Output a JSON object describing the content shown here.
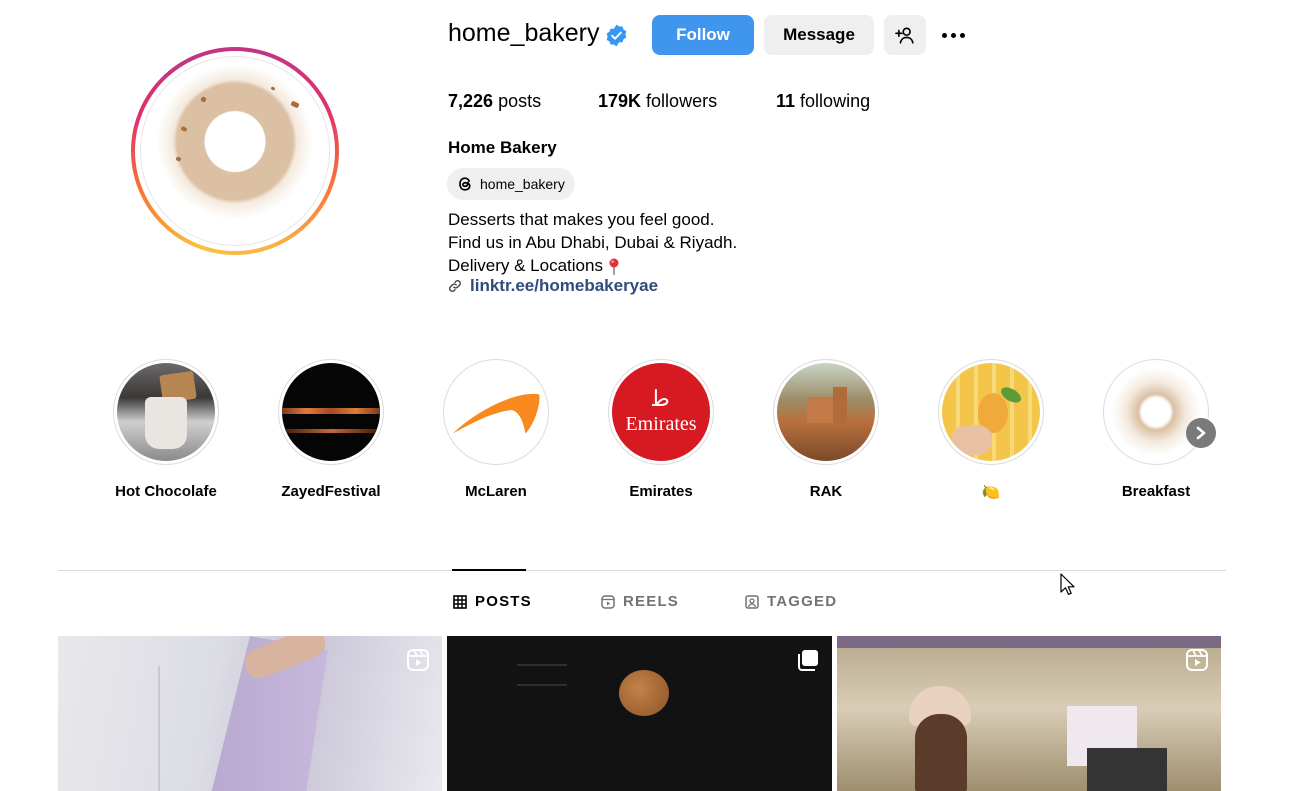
{
  "profile": {
    "username": "home_bakery",
    "display_name": "Home Bakery",
    "threads_handle": "home_bakery",
    "bio_lines": [
      "Desserts that makes you feel good.",
      "Find us in Abu Dhabi, Dubai & Riyadh.",
      "Delivery & Locations"
    ],
    "link": "linktr.ee/homebakeryae",
    "verified": true
  },
  "actions": {
    "follow_label": "Follow",
    "message_label": "Message"
  },
  "stats": {
    "posts_count": "7,226",
    "posts_label": "posts",
    "followers_count": "179K",
    "followers_label": "followers",
    "following_count": "11",
    "following_label": "following"
  },
  "highlights": [
    {
      "label": "Hot Chocolafe"
    },
    {
      "label": "ZayedFestival"
    },
    {
      "label": "McLaren"
    },
    {
      "label": "Emirates"
    },
    {
      "label": "RAK"
    },
    {
      "label": "🍋"
    },
    {
      "label": "Breakfast"
    }
  ],
  "emirates_logo_text": "Emirates",
  "tabs": [
    {
      "label": "POSTS",
      "active": true
    },
    {
      "label": "REELS",
      "active": false
    },
    {
      "label": "TAGGED",
      "active": false
    }
  ],
  "colors": {
    "follow_button": "#4096ee",
    "secondary_button": "#efefef",
    "link": "#304b7c",
    "verified_badge": "#3897f0"
  },
  "icons": {
    "verified": "verified-badge-icon",
    "add_user": "add-user-icon",
    "more": "more-options-icon",
    "threads": "threads-icon",
    "link": "link-icon",
    "pin": "pin-icon",
    "grid": "grid-icon",
    "reels": "reels-icon",
    "tagged": "tagged-icon",
    "next": "chevron-right-icon"
  }
}
